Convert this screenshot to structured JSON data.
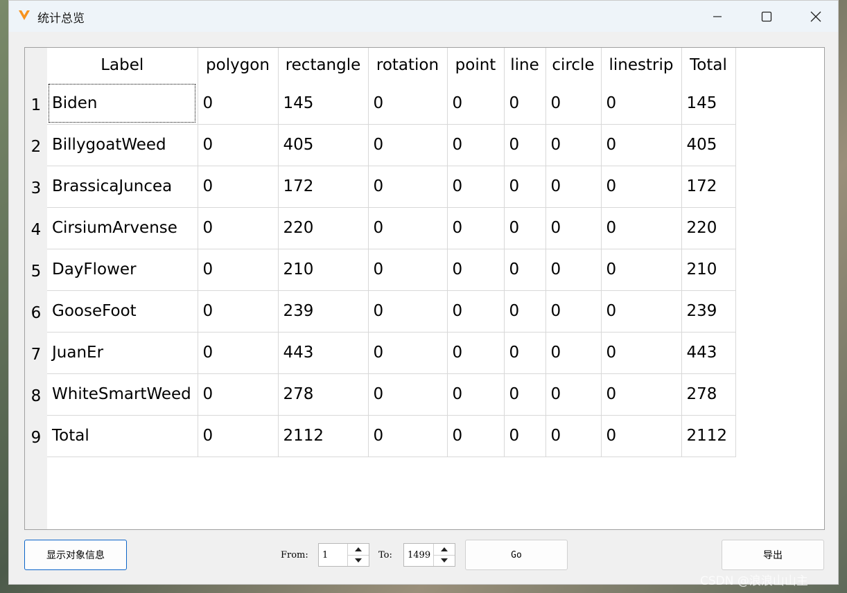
{
  "window": {
    "title": "统计总览",
    "controls": {
      "minimize_icon": "minimize-icon",
      "maximize_icon": "maximize-icon",
      "close_icon": "close-icon"
    }
  },
  "table": {
    "columns": [
      "Label",
      "polygon",
      "rectangle",
      "rotation",
      "point",
      "line",
      "circle",
      "linestrip",
      "Total"
    ],
    "rows": [
      {
        "num": "1",
        "cells": [
          "Biden",
          "0",
          "145",
          "0",
          "0",
          "0",
          "0",
          "0",
          "145"
        ]
      },
      {
        "num": "2",
        "cells": [
          "BillygoatWeed",
          "0",
          "405",
          "0",
          "0",
          "0",
          "0",
          "0",
          "405"
        ]
      },
      {
        "num": "3",
        "cells": [
          "BrassicaJuncea",
          "0",
          "172",
          "0",
          "0",
          "0",
          "0",
          "0",
          "172"
        ]
      },
      {
        "num": "4",
        "cells": [
          "CirsiumArvense",
          "0",
          "220",
          "0",
          "0",
          "0",
          "0",
          "0",
          "220"
        ]
      },
      {
        "num": "5",
        "cells": [
          "DayFlower",
          "0",
          "210",
          "0",
          "0",
          "0",
          "0",
          "0",
          "210"
        ]
      },
      {
        "num": "6",
        "cells": [
          "GooseFoot",
          "0",
          "239",
          "0",
          "0",
          "0",
          "0",
          "0",
          "239"
        ]
      },
      {
        "num": "7",
        "cells": [
          "JuanEr",
          "0",
          "443",
          "0",
          "0",
          "0",
          "0",
          "0",
          "443"
        ]
      },
      {
        "num": "8",
        "cells": [
          "WhiteSmartWeed",
          "0",
          "278",
          "0",
          "0",
          "0",
          "0",
          "0",
          "278"
        ]
      },
      {
        "num": "9",
        "cells": [
          "Total",
          "0",
          "2112",
          "0",
          "0",
          "0",
          "0",
          "0",
          "2112"
        ]
      }
    ]
  },
  "bottom": {
    "show_object_info": "显示对象信息",
    "from_label": "From:",
    "from_value": "1",
    "to_label": "To:",
    "to_value": "1499",
    "go": "Go",
    "export": "导出"
  },
  "watermark": "CSDN @浪浪山山主",
  "colors": {
    "logo": "#f7931e",
    "titlebar": "#eef4f9",
    "focus_border": "#0a64c8"
  }
}
